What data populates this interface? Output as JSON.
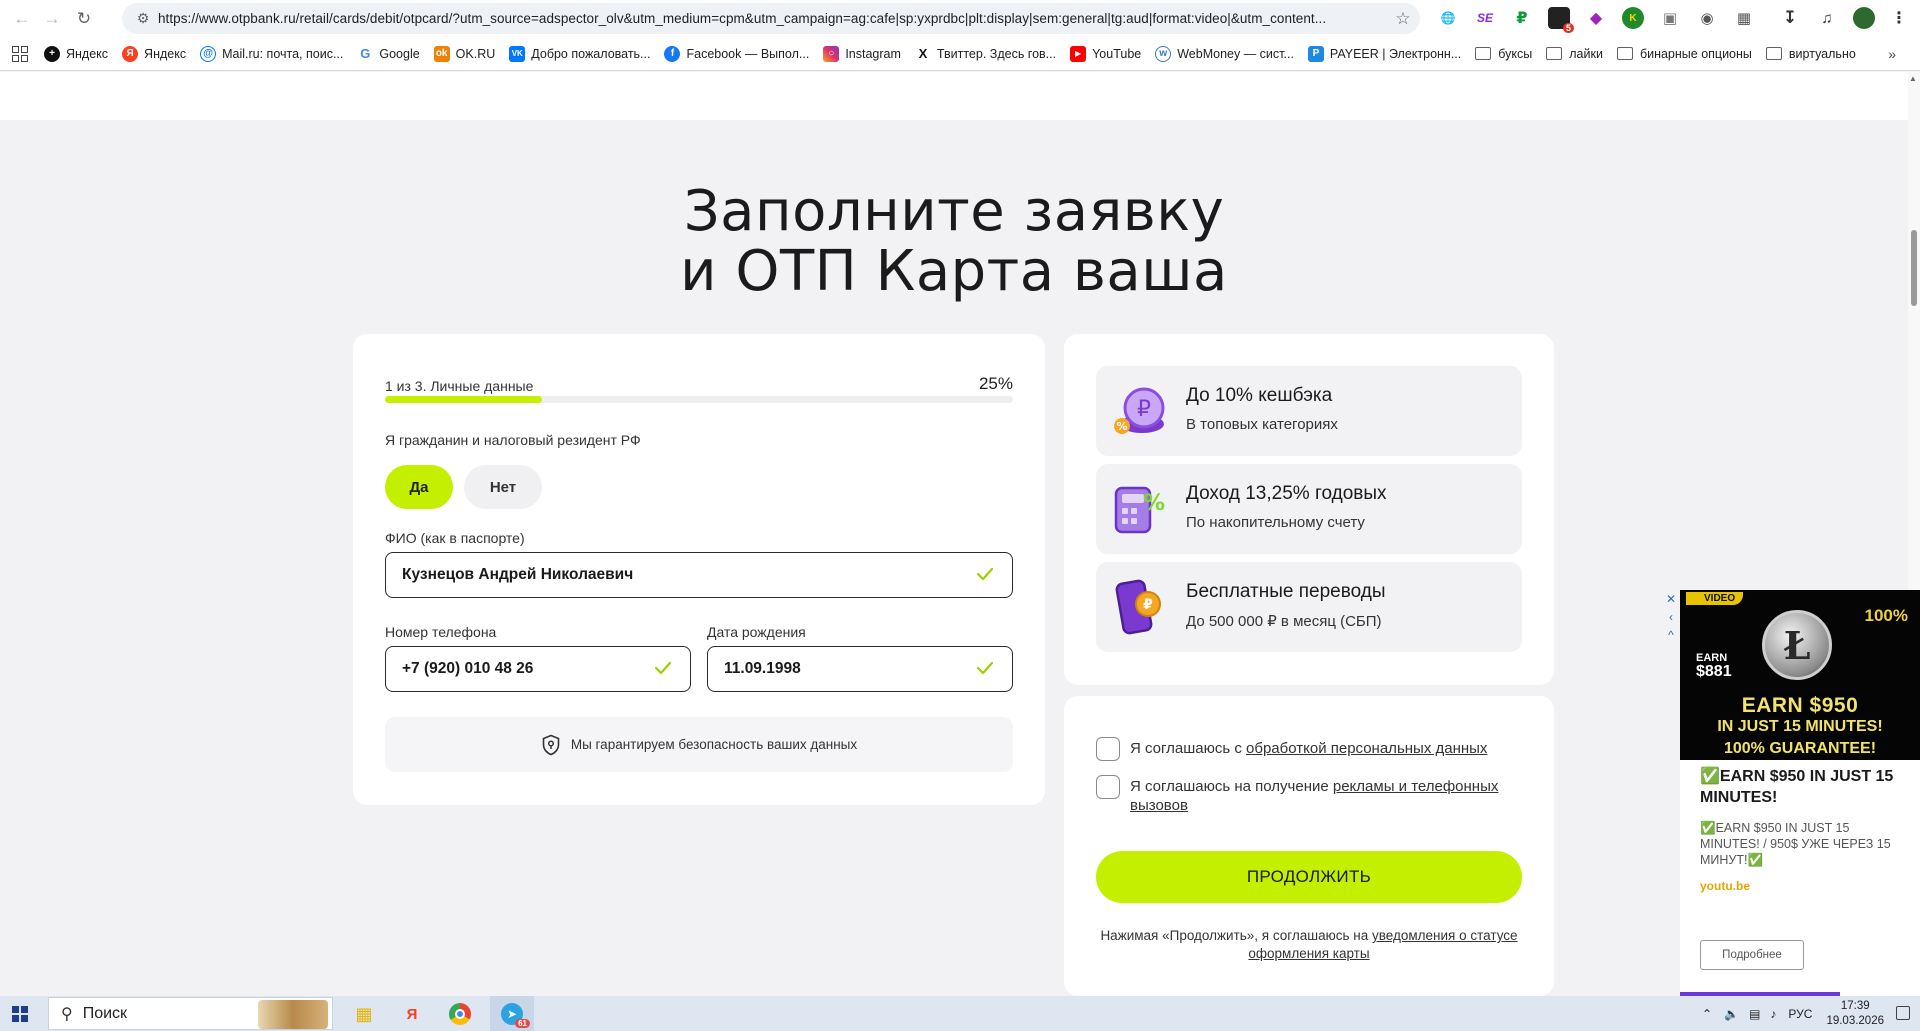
{
  "browser": {
    "url": "https://www.otpbank.ru/retail/cards/debit/otpcard/?utm_source=adspector_olv&utm_medium=cpm&utm_campaign=ag:cafe|sp:yxprdbc|plt:display|sem:general|tg:aud|format:video|&utm_content...",
    "extension_badge": "5",
    "bookmarks": [
      "Яндекс",
      "Яндекс",
      "Mail.ru: почта, поис...",
      "Google",
      "OK.RU",
      "Добро пожаловать...",
      "Facebook — Выпол...",
      "Instagram",
      "Твиттер. Здесь гов...",
      "YouTube",
      "WebMoney — сист...",
      "PAYEER | Электронн...",
      "буксы",
      "лайки",
      "бинарные опционы",
      "виртуально"
    ]
  },
  "page": {
    "headline_line1": "Заполните заявку",
    "headline_line2": "и ОТП Карта ваша",
    "accent_color": "#c4f000"
  },
  "form": {
    "step_label": "1 из 3. Личные данные",
    "progress_text": "25%",
    "progress_fraction": 0.25,
    "resident_question": "Я гражданин и налоговый резидент РФ",
    "yes_label": "Да",
    "no_label": "Нет",
    "selected": "Да",
    "fio_label": "ФИО (как в паспорте)",
    "fio_value": "Кузнецов Андрей Николаевич",
    "phone_label": "Номер телефона",
    "phone_value": "+7 (920) 010 48 26",
    "birth_label": "Дата рождения",
    "birth_value": "11.09.1998",
    "security_text": "Мы гарантируем безопасность ваших данных"
  },
  "benefits": [
    {
      "title": "До 10% кешбэка",
      "subtitle": "В топовых категориях",
      "icon": "cashback-coin-icon"
    },
    {
      "title": "Доход 13,25% годовых",
      "subtitle": "По накопительному счету",
      "icon": "calculator-percent-icon"
    },
    {
      "title": "Бесплатные переводы",
      "subtitle": "До 500 000 ₽ в месяц (СБП)",
      "icon": "phone-ruble-icon"
    }
  ],
  "consent": {
    "c1_prefix": "Я соглашаюсь с ",
    "c1_link": "обработкой персональных данных",
    "c2_prefix": "Я соглашаюсь на получение ",
    "c2_link": "рекламы и телефонных вызовов",
    "cta": "ПРОДОЛЖИТЬ",
    "fine_prefix": "Нажимая «Продолжить», я соглашаюсь на ",
    "fine_link": "уведомления о статусе оформления карты"
  },
  "ad": {
    "banner_tag": "VIDEO",
    "banner_pct": "100%",
    "banner_earn_small": "EARN",
    "banner_amount_small": "$881",
    "banner_big": "EARN $950",
    "banner_mid": "IN JUST 15 MINUTES!",
    "banner_low": "100% GUARANTEE!",
    "title": "✅EARN $950 IN JUST 15 MINUTES!",
    "description": "✅EARN $950 IN JUST 15 MINUTES! / 950$ УЖЕ ЧЕРЕЗ 15 МИНУТ!✅",
    "domain": "youtu.be",
    "button": "Подробнее",
    "close": "✕",
    "collapse": "‹",
    "up": "^"
  },
  "taskbar": {
    "search_placeholder": "Поиск",
    "telegram_badge": "61",
    "lang": "РУС",
    "time": "17:39",
    "date": "19.03.2026"
  }
}
